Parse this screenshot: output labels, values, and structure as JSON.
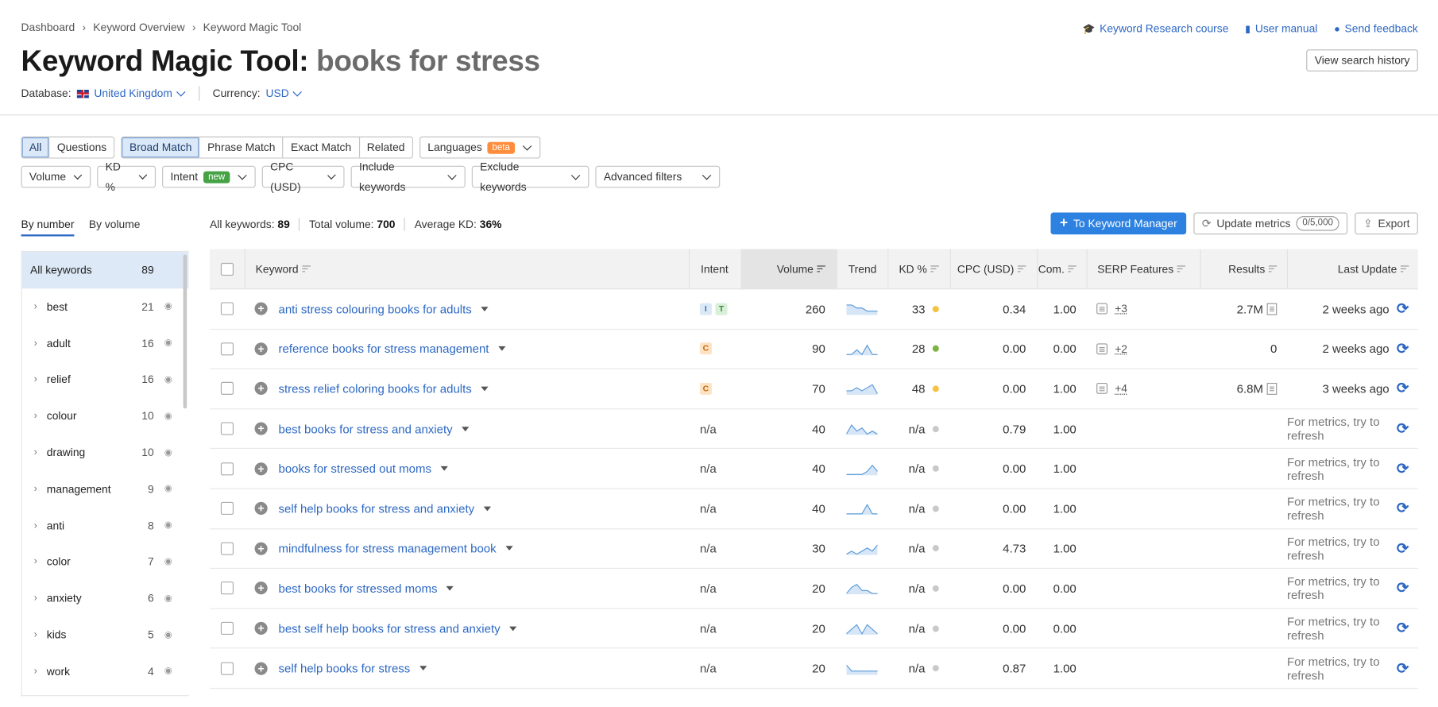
{
  "breadcrumbs": [
    "Dashboard",
    "Keyword Overview",
    "Keyword Magic Tool"
  ],
  "title": {
    "tool": "Keyword Magic Tool:",
    "query": "books for stress"
  },
  "database": {
    "label": "Database:",
    "value": "United Kingdom"
  },
  "currency": {
    "label": "Currency:",
    "value": "USD"
  },
  "top_links": [
    "Keyword Research course",
    "User manual",
    "Send feedback"
  ],
  "view_history": "View search history",
  "filters": {
    "scope_tabs": [
      "All",
      "Questions"
    ],
    "match_tabs": [
      "Broad Match",
      "Phrase Match",
      "Exact Match",
      "Related"
    ],
    "languages": "Languages",
    "beta": "beta",
    "row2": [
      "Volume",
      "KD %",
      "Intent",
      "CPC (USD)",
      "Include keywords",
      "Exclude keywords",
      "Advanced filters"
    ],
    "new": "new"
  },
  "side_tabs": [
    "By number",
    "By volume"
  ],
  "summary": {
    "all_keywords_label": "All keywords:",
    "all_keywords": "89",
    "total_volume_label": "Total volume:",
    "total_volume": "700",
    "avg_kd_label": "Average KD:",
    "avg_kd": "36%"
  },
  "actions": {
    "to_manager": "To Keyword Manager",
    "update": "Update metrics",
    "update_count": "0/5,000",
    "export": "Export"
  },
  "sidebar": {
    "all": {
      "label": "All keywords",
      "count": "89"
    },
    "groups": [
      {
        "label": "best",
        "count": "21"
      },
      {
        "label": "adult",
        "count": "16"
      },
      {
        "label": "relief",
        "count": "16"
      },
      {
        "label": "colour",
        "count": "10"
      },
      {
        "label": "drawing",
        "count": "10"
      },
      {
        "label": "management",
        "count": "9"
      },
      {
        "label": "anti",
        "count": "8"
      },
      {
        "label": "color",
        "count": "7"
      },
      {
        "label": "anxiety",
        "count": "6"
      },
      {
        "label": "kids",
        "count": "5"
      },
      {
        "label": "work",
        "count": "4"
      }
    ]
  },
  "table": {
    "headers": {
      "keyword": "Keyword",
      "intent": "Intent",
      "volume": "Volume",
      "trend": "Trend",
      "kd": "KD %",
      "cpc": "CPC (USD)",
      "com": "Com.",
      "serp": "SERP Features",
      "results": "Results",
      "update": "Last Update"
    },
    "colors": {
      "yellow": "#f5c242",
      "green": "#7cb342",
      "grey": "#c9c9c9"
    },
    "rows": [
      {
        "keyword": "anti stress colouring books for adults",
        "intent": [
          "I",
          "T"
        ],
        "volume": "260",
        "kd": "33",
        "kd_color": "#f5c242",
        "cpc": "0.34",
        "com": "1.00",
        "serp": "+3",
        "results": "2.7M",
        "update": "2 weeks ago",
        "trend": [
          3,
          3,
          2,
          2,
          1,
          1,
          1
        ]
      },
      {
        "keyword": "reference books for stress management",
        "intent": [
          "C"
        ],
        "volume": "90",
        "kd": "28",
        "kd_color": "#7cb342",
        "cpc": "0.00",
        "com": "0.00",
        "serp": "+2",
        "results": "0",
        "update": "2 weeks ago",
        "trend": [
          0,
          0,
          1,
          0,
          2,
          0,
          0
        ]
      },
      {
        "keyword": "stress relief coloring books for adults",
        "intent": [
          "C"
        ],
        "volume": "70",
        "kd": "48",
        "kd_color": "#f5c242",
        "cpc": "0.00",
        "com": "1.00",
        "serp": "+4",
        "results": "6.8M",
        "update": "3 weeks ago",
        "trend": [
          1,
          1,
          2,
          1,
          2,
          3,
          0
        ]
      },
      {
        "keyword": "best books for stress and anxiety",
        "intent": [],
        "volume": "40",
        "kd": "n/a",
        "kd_color": "#c9c9c9",
        "cpc": "0.79",
        "com": "1.00",
        "serp": "",
        "results": "",
        "update": "For metrics, try to refresh",
        "trend": [
          0,
          3,
          1,
          2,
          0,
          1,
          0
        ]
      },
      {
        "keyword": "books for stressed out moms",
        "intent": [],
        "volume": "40",
        "kd": "n/a",
        "kd_color": "#c9c9c9",
        "cpc": "0.00",
        "com": "1.00",
        "serp": "",
        "results": "",
        "update": "For metrics, try to refresh",
        "trend": [
          0,
          0,
          0,
          0,
          1,
          3,
          1
        ]
      },
      {
        "keyword": "self help books for stress and anxiety",
        "intent": [],
        "volume": "40",
        "kd": "n/a",
        "kd_color": "#c9c9c9",
        "cpc": "0.00",
        "com": "1.00",
        "serp": "",
        "results": "",
        "update": "For metrics, try to refresh",
        "trend": [
          0,
          0,
          0,
          0,
          3,
          0,
          0
        ]
      },
      {
        "keyword": "mindfulness for stress management book",
        "intent": [],
        "volume": "30",
        "kd": "n/a",
        "kd_color": "#c9c9c9",
        "cpc": "4.73",
        "com": "1.00",
        "serp": "",
        "results": "",
        "update": "For metrics, try to refresh",
        "trend": [
          0,
          1,
          0,
          1,
          2,
          1,
          3
        ]
      },
      {
        "keyword": "best books for stressed moms",
        "intent": [],
        "volume": "20",
        "kd": "n/a",
        "kd_color": "#c9c9c9",
        "cpc": "0.00",
        "com": "0.00",
        "serp": "",
        "results": "",
        "update": "For metrics, try to refresh",
        "trend": [
          0,
          2,
          3,
          1,
          1,
          0,
          0
        ]
      },
      {
        "keyword": "best self help books for stress and anxiety",
        "intent": [],
        "volume": "20",
        "kd": "n/a",
        "kd_color": "#c9c9c9",
        "cpc": "0.00",
        "com": "0.00",
        "serp": "",
        "results": "",
        "update": "For metrics, try to refresh",
        "trend": [
          0,
          1,
          2,
          0,
          2,
          1,
          0
        ]
      },
      {
        "keyword": "self help books for stress",
        "intent": [],
        "volume": "20",
        "kd": "n/a",
        "kd_color": "#c9c9c9",
        "cpc": "0.87",
        "com": "1.00",
        "serp": "",
        "results": "",
        "update": "For metrics, try to refresh",
        "trend": [
          3,
          1,
          1,
          1,
          1,
          1,
          1
        ]
      }
    ]
  }
}
